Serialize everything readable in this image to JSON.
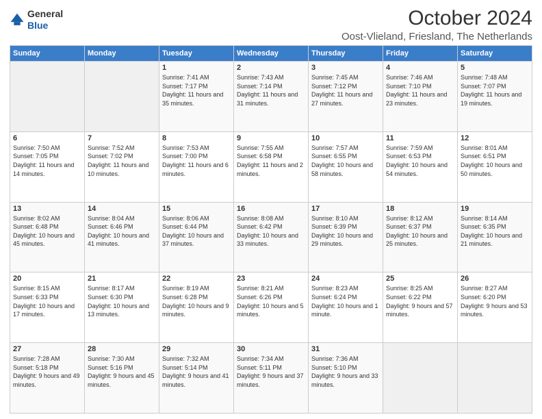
{
  "header": {
    "logo_line1": "General",
    "logo_line2": "Blue",
    "month": "October 2024",
    "location": "Oost-Vlieland, Friesland, The Netherlands"
  },
  "days_of_week": [
    "Sunday",
    "Monday",
    "Tuesday",
    "Wednesday",
    "Thursday",
    "Friday",
    "Saturday"
  ],
  "weeks": [
    [
      {
        "day": "",
        "info": ""
      },
      {
        "day": "",
        "info": ""
      },
      {
        "day": "1",
        "info": "Sunrise: 7:41 AM\nSunset: 7:17 PM\nDaylight: 11 hours and 35 minutes."
      },
      {
        "day": "2",
        "info": "Sunrise: 7:43 AM\nSunset: 7:14 PM\nDaylight: 11 hours and 31 minutes."
      },
      {
        "day": "3",
        "info": "Sunrise: 7:45 AM\nSunset: 7:12 PM\nDaylight: 11 hours and 27 minutes."
      },
      {
        "day": "4",
        "info": "Sunrise: 7:46 AM\nSunset: 7:10 PM\nDaylight: 11 hours and 23 minutes."
      },
      {
        "day": "5",
        "info": "Sunrise: 7:48 AM\nSunset: 7:07 PM\nDaylight: 11 hours and 19 minutes."
      }
    ],
    [
      {
        "day": "6",
        "info": "Sunrise: 7:50 AM\nSunset: 7:05 PM\nDaylight: 11 hours and 14 minutes."
      },
      {
        "day": "7",
        "info": "Sunrise: 7:52 AM\nSunset: 7:02 PM\nDaylight: 11 hours and 10 minutes."
      },
      {
        "day": "8",
        "info": "Sunrise: 7:53 AM\nSunset: 7:00 PM\nDaylight: 11 hours and 6 minutes."
      },
      {
        "day": "9",
        "info": "Sunrise: 7:55 AM\nSunset: 6:58 PM\nDaylight: 11 hours and 2 minutes."
      },
      {
        "day": "10",
        "info": "Sunrise: 7:57 AM\nSunset: 6:55 PM\nDaylight: 10 hours and 58 minutes."
      },
      {
        "day": "11",
        "info": "Sunrise: 7:59 AM\nSunset: 6:53 PM\nDaylight: 10 hours and 54 minutes."
      },
      {
        "day": "12",
        "info": "Sunrise: 8:01 AM\nSunset: 6:51 PM\nDaylight: 10 hours and 50 minutes."
      }
    ],
    [
      {
        "day": "13",
        "info": "Sunrise: 8:02 AM\nSunset: 6:48 PM\nDaylight: 10 hours and 45 minutes."
      },
      {
        "day": "14",
        "info": "Sunrise: 8:04 AM\nSunset: 6:46 PM\nDaylight: 10 hours and 41 minutes."
      },
      {
        "day": "15",
        "info": "Sunrise: 8:06 AM\nSunset: 6:44 PM\nDaylight: 10 hours and 37 minutes."
      },
      {
        "day": "16",
        "info": "Sunrise: 8:08 AM\nSunset: 6:42 PM\nDaylight: 10 hours and 33 minutes."
      },
      {
        "day": "17",
        "info": "Sunrise: 8:10 AM\nSunset: 6:39 PM\nDaylight: 10 hours and 29 minutes."
      },
      {
        "day": "18",
        "info": "Sunrise: 8:12 AM\nSunset: 6:37 PM\nDaylight: 10 hours and 25 minutes."
      },
      {
        "day": "19",
        "info": "Sunrise: 8:14 AM\nSunset: 6:35 PM\nDaylight: 10 hours and 21 minutes."
      }
    ],
    [
      {
        "day": "20",
        "info": "Sunrise: 8:15 AM\nSunset: 6:33 PM\nDaylight: 10 hours and 17 minutes."
      },
      {
        "day": "21",
        "info": "Sunrise: 8:17 AM\nSunset: 6:30 PM\nDaylight: 10 hours and 13 minutes."
      },
      {
        "day": "22",
        "info": "Sunrise: 8:19 AM\nSunset: 6:28 PM\nDaylight: 10 hours and 9 minutes."
      },
      {
        "day": "23",
        "info": "Sunrise: 8:21 AM\nSunset: 6:26 PM\nDaylight: 10 hours and 5 minutes."
      },
      {
        "day": "24",
        "info": "Sunrise: 8:23 AM\nSunset: 6:24 PM\nDaylight: 10 hours and 1 minute."
      },
      {
        "day": "25",
        "info": "Sunrise: 8:25 AM\nSunset: 6:22 PM\nDaylight: 9 hours and 57 minutes."
      },
      {
        "day": "26",
        "info": "Sunrise: 8:27 AM\nSunset: 6:20 PM\nDaylight: 9 hours and 53 minutes."
      }
    ],
    [
      {
        "day": "27",
        "info": "Sunrise: 7:28 AM\nSunset: 5:18 PM\nDaylight: 9 hours and 49 minutes."
      },
      {
        "day": "28",
        "info": "Sunrise: 7:30 AM\nSunset: 5:16 PM\nDaylight: 9 hours and 45 minutes."
      },
      {
        "day": "29",
        "info": "Sunrise: 7:32 AM\nSunset: 5:14 PM\nDaylight: 9 hours and 41 minutes."
      },
      {
        "day": "30",
        "info": "Sunrise: 7:34 AM\nSunset: 5:11 PM\nDaylight: 9 hours and 37 minutes."
      },
      {
        "day": "31",
        "info": "Sunrise: 7:36 AM\nSunset: 5:10 PM\nDaylight: 9 hours and 33 minutes."
      },
      {
        "day": "",
        "info": ""
      },
      {
        "day": "",
        "info": ""
      }
    ]
  ]
}
